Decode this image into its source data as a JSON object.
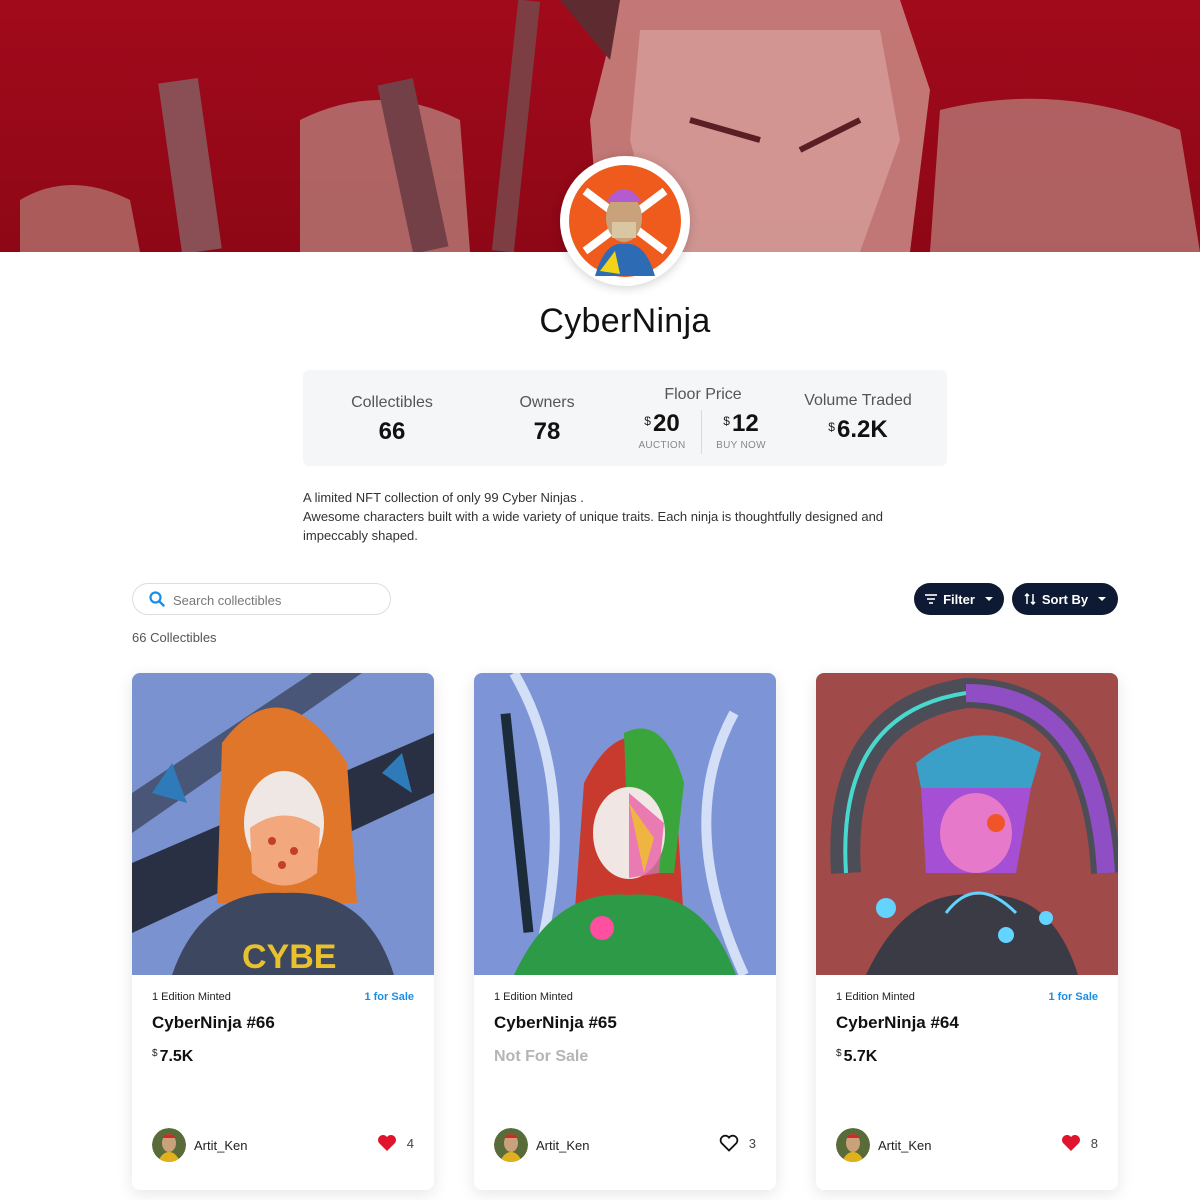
{
  "collection": {
    "name": "CyberNinja",
    "description_line1": "A limited NFT collection of only 99 Cyber Ninjas .",
    "description_line2": "Awesome characters built with a wide variety of unique traits. Each ninja is thoughtfully designed and impeccably shaped."
  },
  "stats": {
    "collectibles_label": "Collectibles",
    "collectibles_value": "66",
    "owners_label": "Owners",
    "owners_value": "78",
    "floor_label": "Floor Price",
    "floor_auction_value": "20",
    "floor_auction_note": "AUCTION",
    "floor_buynow_value": "12",
    "floor_buynow_note": "BUY NOW",
    "volume_label": "Volume Traded",
    "volume_value": "6.2K",
    "currency": "$"
  },
  "toolbar": {
    "search_placeholder": "Search collectibles",
    "filter_label": "Filter",
    "sort_label": "Sort By",
    "count_text": "66 Collectibles"
  },
  "cards": [
    {
      "edition": "1 Edition Minted",
      "sale": "1 for Sale",
      "name": "CyberNinja #66",
      "price": "7.5K",
      "creator": "Artit_Ken",
      "likes": "4",
      "liked": true
    },
    {
      "edition": "1 Edition Minted",
      "sale": "",
      "name": "CyberNinja #65",
      "not_for_sale": "Not For Sale",
      "creator": "Artit_Ken",
      "likes": "3",
      "liked": false
    },
    {
      "edition": "1 Edition Minted",
      "sale": "1 for Sale",
      "name": "CyberNinja #64",
      "price": "5.7K",
      "creator": "Artit_Ken",
      "likes": "8",
      "liked": true
    }
  ],
  "colors": {
    "banner": "#a10a1b",
    "button_dark": "#0e1a33",
    "accent_blue": "#1a8ee6",
    "heart_red": "#e0152d"
  },
  "icons": [
    "search-icon",
    "filter-icon",
    "sort-icon",
    "heart-filled-icon",
    "heart-outline-icon"
  ]
}
